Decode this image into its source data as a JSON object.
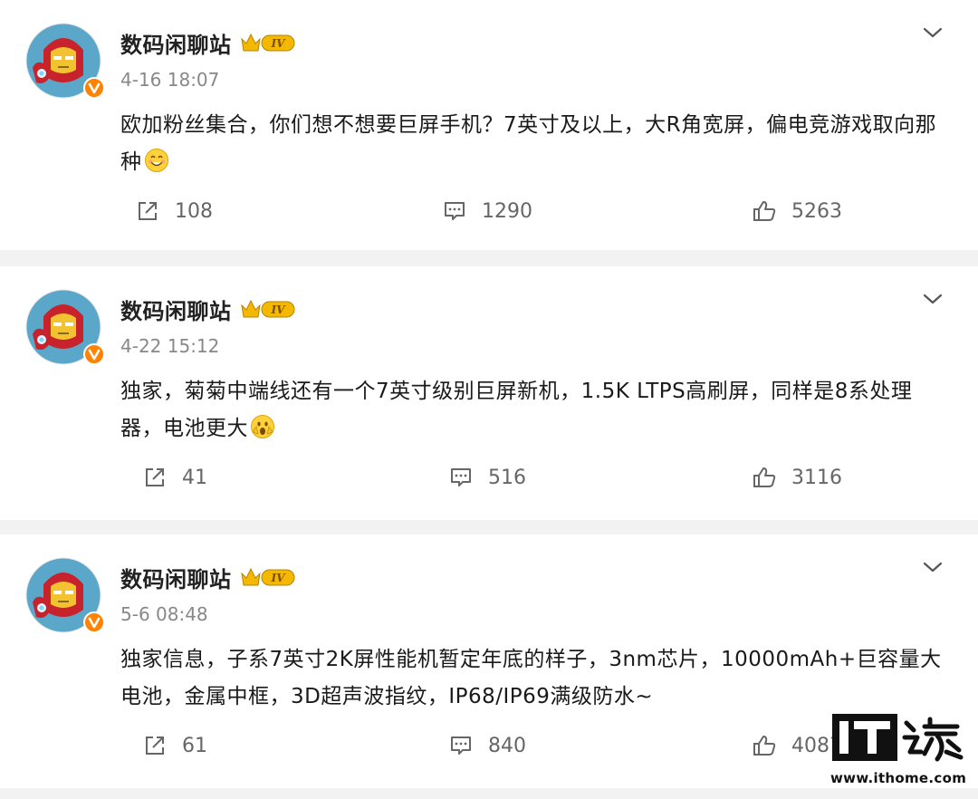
{
  "posts": [
    {
      "author": "数码闲聊站",
      "level_badge": "IV",
      "timestamp": "4-16 18:07",
      "text": "欧加粉丝集合，你们想不想要巨屏手机？7英寸及以上，大R角宽屏，偏电竞游戏取向那种",
      "emoji": "smile-emoji",
      "reposts": "108",
      "comments": "1290",
      "likes": "5263"
    },
    {
      "author": "数码闲聊站",
      "level_badge": "IV",
      "timestamp": "4-22 15:12",
      "text": "独家，菊菊中端线还有一个7英寸级别巨屏新机，1.5K LTPS高刷屏，同样是8系处理器，电池更大",
      "emoji": "surprised-emoji",
      "reposts": "41",
      "comments": "516",
      "likes": "3116"
    },
    {
      "author": "数码闲聊站",
      "level_badge": "IV",
      "timestamp": "5-6 08:48",
      "text": "独家信息，子系7英寸2K屏性能机暂定年底的样子，3nm芯片，10000mAh+巨容量大电池，金属中框，3D超声波指纹，IP68/IP69满级防水~",
      "emoji": "",
      "reposts": "61",
      "comments": "840",
      "likes": "4087"
    }
  ],
  "watermark": {
    "logo_text": "IT之家",
    "url": "www.ithome.com"
  },
  "colors": {
    "background": "#f2f2f2",
    "card": "#ffffff",
    "muted_text": "#888888",
    "badge_gold": "#f5b800",
    "verified_orange": "#ff8200"
  },
  "icons": [
    "repost-icon",
    "comment-icon",
    "like-icon",
    "chevron-down-icon",
    "crown-badge-icon",
    "verified-icon"
  ]
}
